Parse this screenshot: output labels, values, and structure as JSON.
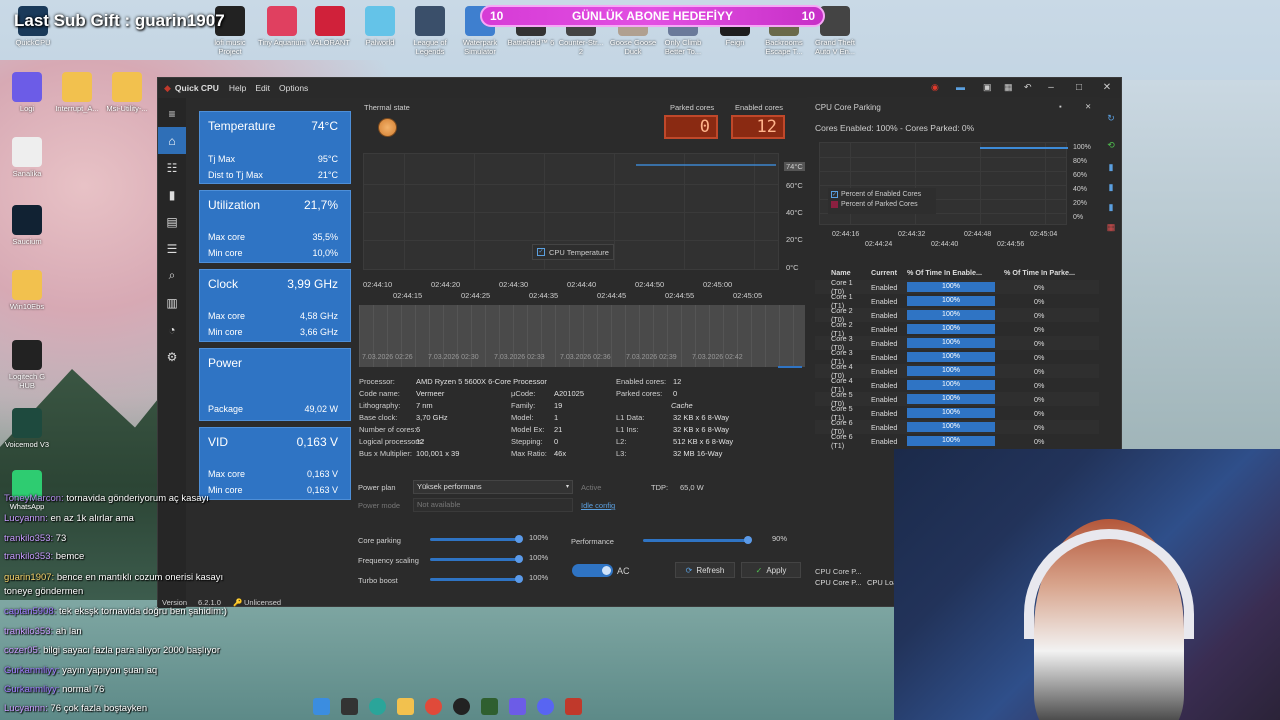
{
  "overlay": {
    "last_sub_gift": "Last Sub Gift : guarin1907",
    "goal_text": "GÜNLÜK ABONE HEDEFİYY",
    "goal_left": "10",
    "goal_right": "10"
  },
  "desktop_icons": [
    {
      "label": "QuickCPU"
    },
    {
      "label": "lofi music Project"
    },
    {
      "label": "Tiny Aquarium"
    },
    {
      "label": "VALORANT"
    },
    {
      "label": "Palworld"
    },
    {
      "label": "League of Legends"
    },
    {
      "label": "Waterpark Simulator"
    },
    {
      "label": "Battlefield™ 6"
    },
    {
      "label": "Counter-Str... 2"
    },
    {
      "label": "Goose Goose Duck"
    },
    {
      "label": "Only Climb Better To..."
    },
    {
      "label": "Feign"
    },
    {
      "label": "Backrooms Escape T..."
    },
    {
      "label": "Grand Theft Auto V En..."
    },
    {
      "label": "Logi"
    },
    {
      "label": "Interrupt_A..."
    },
    {
      "label": "Msi-Utility-..."
    },
    {
      "label": "Sanalika"
    },
    {
      "label": "Saucium"
    },
    {
      "label": "Win10Ebs"
    },
    {
      "label": "Logitech G HUB"
    },
    {
      "label": "Voicemod V3"
    },
    {
      "label": "WhatsApp"
    }
  ],
  "window": {
    "app_name": "Quick CPU",
    "menus": [
      "Help",
      "Edit",
      "Options"
    ]
  },
  "cards": {
    "temperature": {
      "title": "Temperature",
      "value": "74°C",
      "r1": "Tj Max",
      "r1v": "95°C",
      "r2": "Dist to Tj Max",
      "r2v": "21°C"
    },
    "utilization": {
      "title": "Utilization",
      "value": "21,7%",
      "r1": "Max core",
      "r1v": "35,5%",
      "r2": "Min core",
      "r2v": "10,0%"
    },
    "clock": {
      "title": "Clock",
      "value": "3,99 GHz",
      "r1": "Max core",
      "r1v": "4,58 GHz",
      "r2": "Min core",
      "r2v": "3,66 GHz"
    },
    "power": {
      "title": "Power",
      "r1": "Package",
      "r1v": "49,02 W"
    },
    "vid": {
      "title": "VID",
      "value": "0,163 V",
      "r1": "Max core",
      "r1v": "0,163 V",
      "r2": "Min core",
      "r2v": "0,163 V"
    }
  },
  "thermal_state": "Thermal state",
  "parked_cores": {
    "label": "Parked cores",
    "value": "0"
  },
  "enabled_cores": {
    "label": "Enabled cores",
    "value": "12"
  },
  "temp_graph": {
    "y_ticks": [
      "74°C",
      "60°C",
      "40°C",
      "20°C",
      "0°C"
    ],
    "x_top": [
      "02:44:10",
      "02:44:20",
      "02:44:30",
      "02:44:40",
      "02:44:50",
      "02:45:00"
    ],
    "x_bottom": [
      "02:44:15",
      "02:44:25",
      "02:44:35",
      "02:44:45",
      "02:44:55",
      "02:45:05"
    ],
    "legend": "CPU Temperature"
  },
  "timeline_labels": [
    "7.03.2026 02:26",
    "7.03.2026 02:30",
    "7.03.2026 02:33",
    "7.03.2026 02:36",
    "7.03.2026 02:39",
    "7.03.2026 02:42"
  ],
  "specs_left": [
    {
      "k": "Processor:",
      "v": "AMD Ryzen 5 5600X 6-Core Processor"
    },
    {
      "k": "Code name:",
      "v": "Vermeer"
    },
    {
      "k": "Lithography:",
      "v": "7 nm"
    },
    {
      "k": "Base clock:",
      "v": "3,70 GHz"
    },
    {
      "k": "Number of cores:",
      "v": "6"
    },
    {
      "k": "Logical processors:",
      "v": "12"
    },
    {
      "k": "Bus x Multiplier:",
      "v": "100,001 x 39"
    }
  ],
  "specs_mid": [
    {
      "k": "μCode:",
      "v": "A201025"
    },
    {
      "k": "Family:",
      "v": "19"
    },
    {
      "k": "Model:",
      "v": "1"
    },
    {
      "k": "Model Ex:",
      "v": "21"
    },
    {
      "k": "Stepping:",
      "v": "0"
    },
    {
      "k": "Max Ratio:",
      "v": "46x"
    }
  ],
  "specs_right": [
    {
      "k": "Enabled cores:",
      "v": "12"
    },
    {
      "k": "Parked cores:",
      "v": "0"
    },
    {
      "k": "",
      "v": "Cache"
    },
    {
      "k": "L1 Data:",
      "v": "32 KB x 6  8-Way"
    },
    {
      "k": "L1 Ins:",
      "v": "32 KB x 6  8-Way"
    },
    {
      "k": "L2:",
      "v": "512 KB x 6  8-Way"
    },
    {
      "k": "L3:",
      "v": "32 MB  16-Way"
    }
  ],
  "power_plan": {
    "label": "Power plan",
    "value": "Yüksek performans",
    "active": "Active",
    "mode_label": "Power mode",
    "mode_value": "Not available",
    "idle": "Idle config",
    "tdp_label": "TDP:",
    "tdp_value": "65,0 W"
  },
  "sliders": {
    "core_parking": {
      "label": "Core parking",
      "value": "100%"
    },
    "frequency_scaling": {
      "label": "Frequency scaling",
      "value": "100%"
    },
    "turbo_boost": {
      "label": "Turbo boost",
      "value": "100%"
    },
    "performance": {
      "label": "Performance",
      "value": "90%"
    }
  },
  "ac_label": "AC",
  "refresh_label": "Refresh",
  "apply_label": "Apply",
  "version": {
    "label": "Version",
    "value": "6.2.1.0",
    "license": "Unlicensed"
  },
  "parking": {
    "title": "CPU Core Parking",
    "status": "Cores Enabled: 100% - Cores Parked: 0%",
    "y_ticks": [
      "100%",
      "80%",
      "60%",
      "40%",
      "20%",
      "0%"
    ],
    "x_top": [
      "02:44:16",
      "02:44:32",
      "02:44:48",
      "02:45:04"
    ],
    "x_bottom": [
      "02:44:24",
      "02:44:40",
      "02:44:56"
    ],
    "legend1": "Percent of Enabled Cores",
    "legend2": "Percent of Parked Cores",
    "columns": [
      "Name",
      "Current",
      "% Of Time In Enable...",
      "% Of Time In Parke..."
    ],
    "rows": [
      {
        "name": "Core 1 (T0)",
        "current": "Enabled",
        "enabled": "100%",
        "parked": "0%"
      },
      {
        "name": "Core 1 (T1)",
        "current": "Enabled",
        "enabled": "100%",
        "parked": "0%"
      },
      {
        "name": "Core 2 (T0)",
        "current": "Enabled",
        "enabled": "100%",
        "parked": "0%"
      },
      {
        "name": "Core 2 (T1)",
        "current": "Enabled",
        "enabled": "100%",
        "parked": "0%"
      },
      {
        "name": "Core 3 (T0)",
        "current": "Enabled",
        "enabled": "100%",
        "parked": "0%"
      },
      {
        "name": "Core 3 (T1)",
        "current": "Enabled",
        "enabled": "100%",
        "parked": "0%"
      },
      {
        "name": "Core 4 (T0)",
        "current": "Enabled",
        "enabled": "100%",
        "parked": "0%"
      },
      {
        "name": "Core 4 (T1)",
        "current": "Enabled",
        "enabled": "100%",
        "parked": "0%"
      },
      {
        "name": "Core 5 (T0)",
        "current": "Enabled",
        "enabled": "100%",
        "parked": "0%"
      },
      {
        "name": "Core 5 (T1)",
        "current": "Enabled",
        "enabled": "100%",
        "parked": "0%"
      },
      {
        "name": "Core 6 (T0)",
        "current": "Enabled",
        "enabled": "100%",
        "parked": "0%"
      },
      {
        "name": "Core 6 (T1)",
        "current": "Enabled",
        "enabled": "100%",
        "parked": "0%"
      }
    ],
    "tab1": "CPU Core P...",
    "tab2": "CPU Loa"
  },
  "chat": [
    {
      "user": "ToneyMarcon:",
      "msg": "tornavida gönderiyorum aç kasayı"
    },
    {
      "user": "Lucyannn:",
      "msg": "en az 1k alırlar ama"
    },
    {
      "user": "trankilo353:",
      "msg": "73"
    },
    {
      "user": "trankilo353:",
      "msg": "bemce"
    },
    {
      "user": "guarin1907:",
      "msg": "bence en mantıklı cozum onerisi kasayı"
    },
    {
      "user": "",
      "msg": "toneye göndermen"
    },
    {
      "user": "captan5908:",
      "msg": "tek eksşk tornavida doğru ben şahidim:)"
    },
    {
      "user": "trankilo353:",
      "msg": "ah lan"
    },
    {
      "user": "cozer05:",
      "msg": "bilgi sayacı fazla para alıyor 2000 başlıyor"
    },
    {
      "user": "Gurkanmliyy:",
      "msg": "yayın yapıyon şuan aq"
    },
    {
      "user": "Gurkanmliyy:",
      "msg": "normal 76"
    },
    {
      "user": "Lucyannn:",
      "msg": "76 çok fazla boştayken"
    }
  ]
}
